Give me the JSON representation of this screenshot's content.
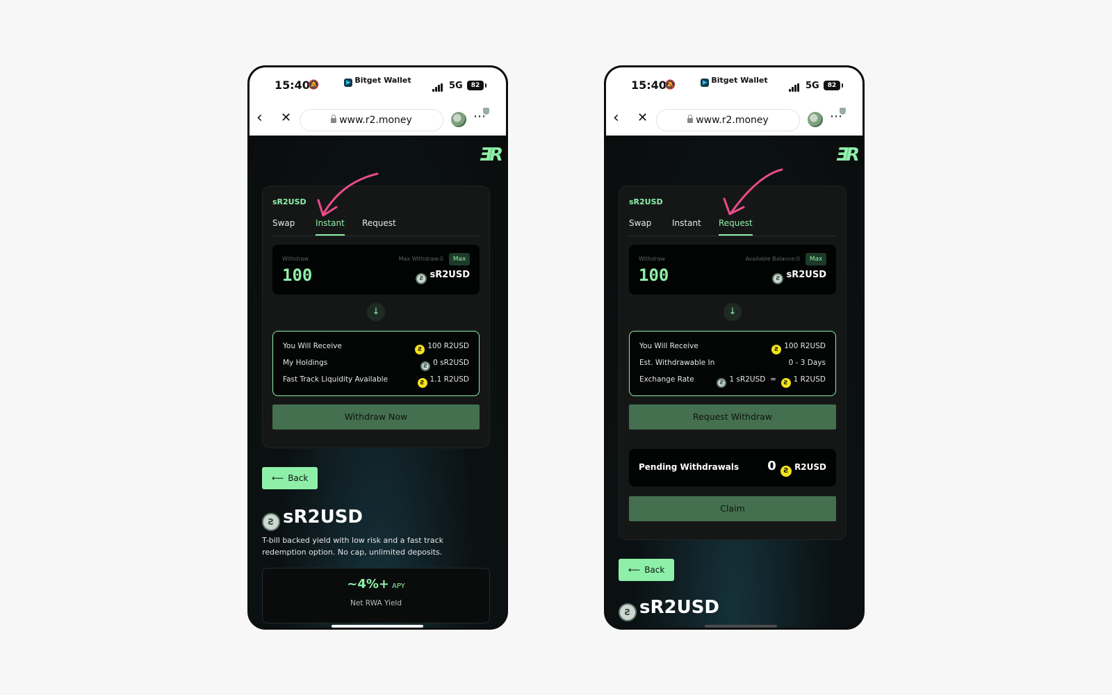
{
  "colors": {
    "accent": "#8ef0a8",
    "annotation": "#ea4c89",
    "button": "#44704f"
  },
  "phones": [
    {
      "status": {
        "time": "15:40",
        "app": "Bitget Wallet",
        "network": "5G",
        "battery": "82"
      },
      "browser": {
        "url": "www.r2.money"
      },
      "card": {
        "token": "sR2USD",
        "tabs": [
          "Swap",
          "Instant",
          "Request"
        ],
        "active_tab": "Instant",
        "input": {
          "label": "Withdraw",
          "max_label": "Max Withdraw:0",
          "max_button": "Max",
          "amount": "100",
          "token": "sR2USD"
        },
        "receive": {
          "rows": [
            {
              "label": "You Will Receive",
              "value": "100 R2USD"
            },
            {
              "label": "My Holdings",
              "value": "0 sR2USD"
            },
            {
              "label": "Fast Track Liquidity Available",
              "value": "1.1 R2USD"
            }
          ]
        },
        "button": "Withdraw Now"
      },
      "back": "Back",
      "title": "sR2USD",
      "description": "T-bill backed yield with low risk and a fast track redemption option. No cap, unlimited deposits.",
      "apy": {
        "value": "~4%+",
        "unit": "APY",
        "label": "Net RWA Yield"
      }
    },
    {
      "status": {
        "time": "15:40",
        "app": "Bitget Wallet",
        "network": "5G",
        "battery": "82"
      },
      "browser": {
        "url": "www.r2.money"
      },
      "card": {
        "token": "sR2USD",
        "tabs": [
          "Swap",
          "Instant",
          "Request"
        ],
        "active_tab": "Request",
        "input": {
          "label": "Withdraw",
          "max_label": "Available Balance:0",
          "max_button": "Max",
          "amount": "100",
          "token": "sR2USD"
        },
        "receive": {
          "rows": [
            {
              "label": "You Will Receive",
              "value": "100 R2USD"
            },
            {
              "label": "Est. Withdrawable In",
              "value": "0 - 3 Days"
            },
            {
              "label": "Exchange Rate",
              "value_left": "1 sR2USD",
              "equals": "=",
              "value_right": "1 R2USD"
            }
          ]
        },
        "button": "Request Withdraw",
        "pending": {
          "label": "Pending Withdrawals",
          "value": "0",
          "unit": "R2USD"
        },
        "claim": "Claim"
      },
      "back": "Back",
      "title": "sR2USD"
    }
  ]
}
